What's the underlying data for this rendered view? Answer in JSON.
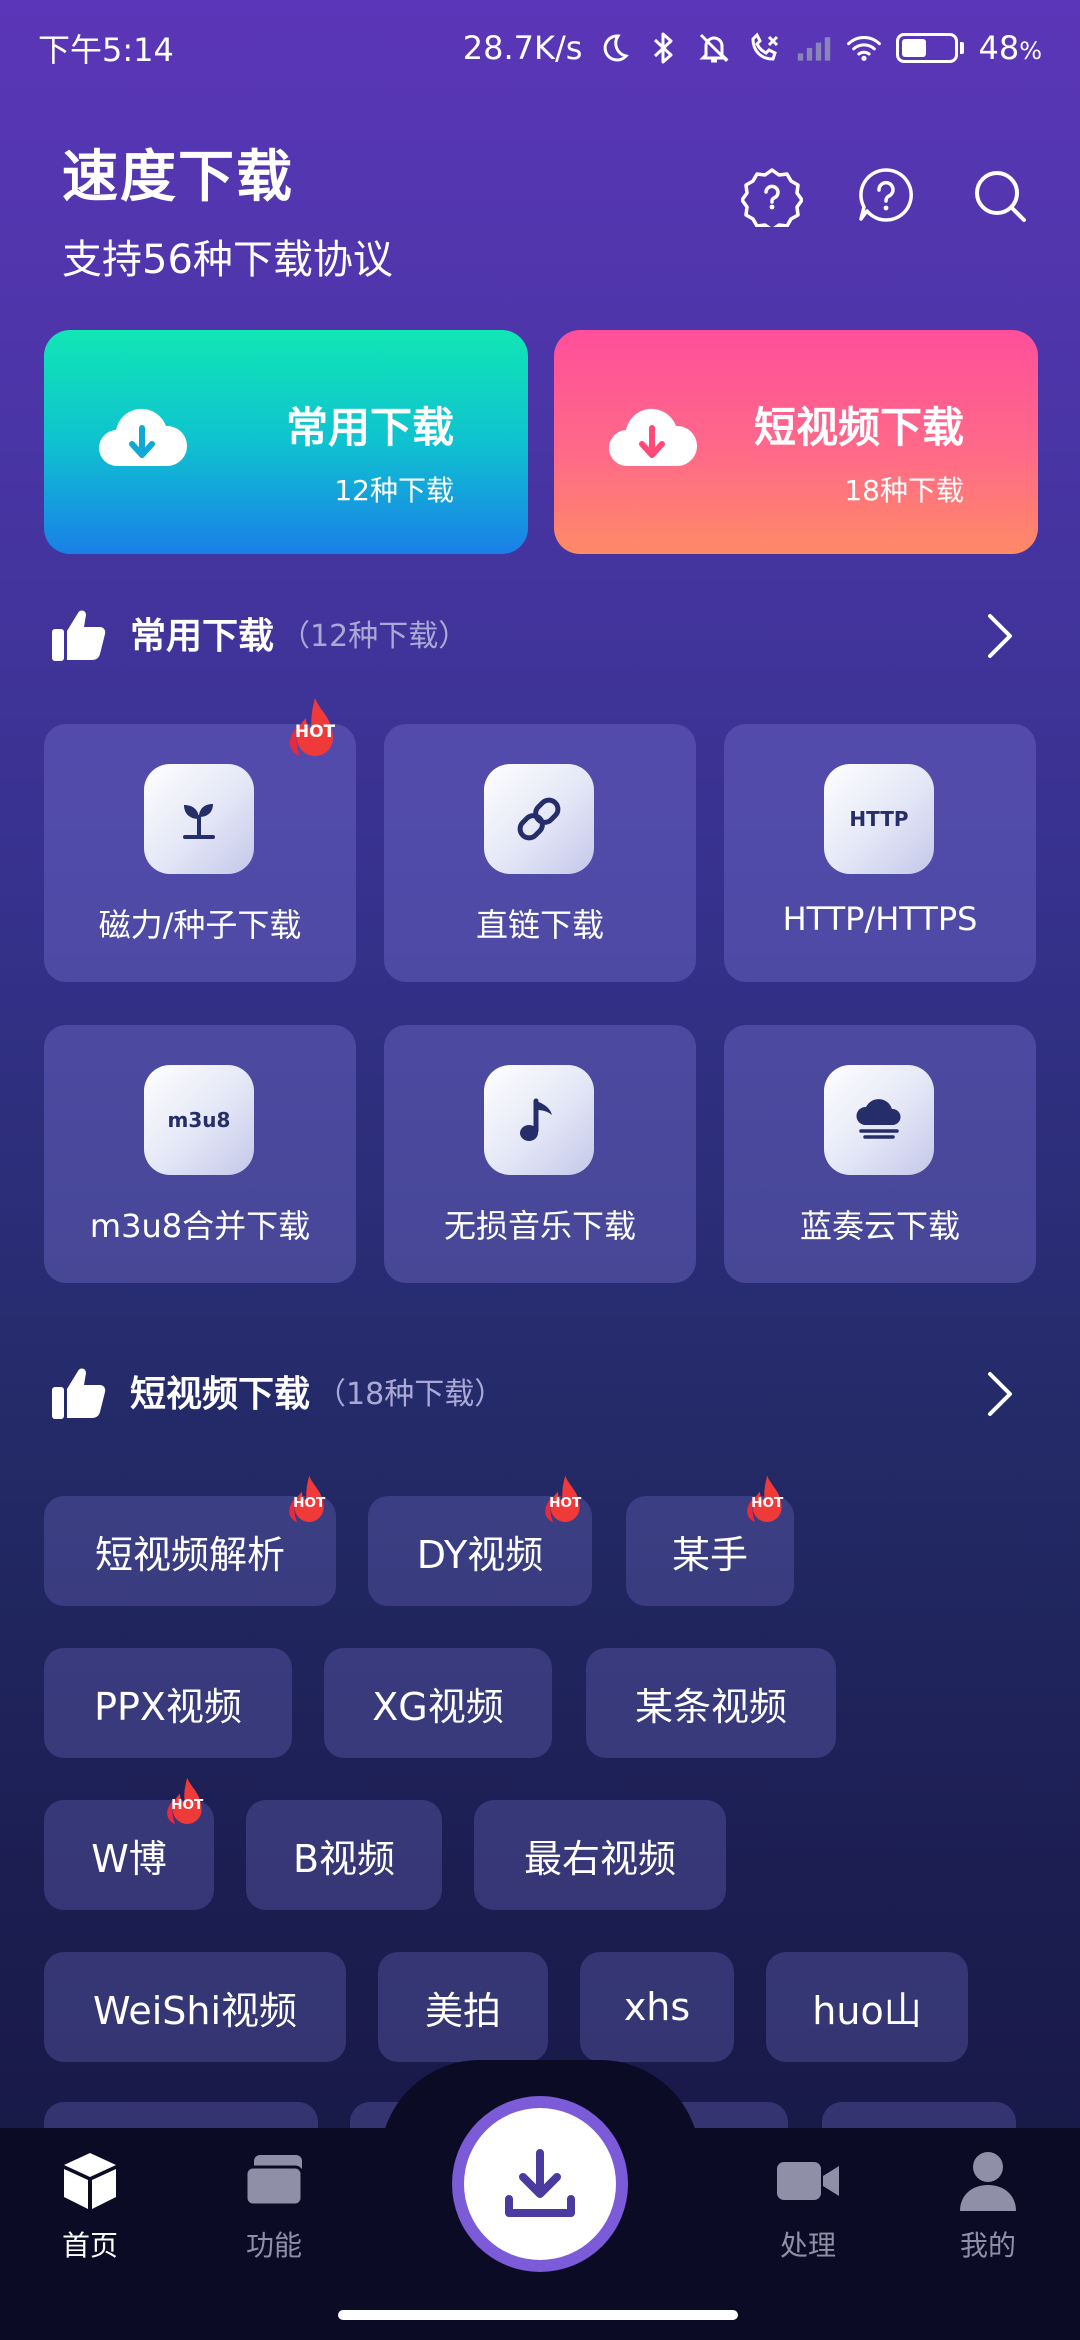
{
  "status_bar": {
    "time": "下午5:14",
    "speed": "28.7K/s",
    "battery": "48",
    "battery_unit": "%",
    "battery_level": 0.48
  },
  "header": {
    "title": "速度下载",
    "subtitle": "支持56种下载协议",
    "icons": [
      "settings-icon",
      "help-icon",
      "search-icon"
    ]
  },
  "big_cards": [
    {
      "title": "常用下载",
      "sub": "12种下载",
      "icon": "cloud-download-icon",
      "color": "#12d8c0"
    },
    {
      "title": "短视频下载",
      "sub": "18种下载",
      "icon": "cloud-download-icon",
      "color": "#ff5f8f"
    }
  ],
  "section_common": {
    "name": "常用下载",
    "count": "（12种下载）",
    "tiles": [
      {
        "label": "磁力/种子下载",
        "icon": "sprout-icon",
        "hot": true
      },
      {
        "label": "直链下载",
        "icon": "link-icon",
        "hot": false
      },
      {
        "label": "HTTP/HTTPS",
        "icon_text": "HTTP",
        "hot": false
      },
      {
        "label": "m3u8合并下载",
        "icon_text": "m3u8",
        "hot": false
      },
      {
        "label": "无损音乐下载",
        "icon": "music-note-icon",
        "hot": false
      },
      {
        "label": "蓝奏云下载",
        "icon": "cloud-icon",
        "hot": false
      }
    ]
  },
  "section_short": {
    "name": "短视频下载",
    "count": "（18种下载）",
    "chips": [
      {
        "label": "短视频解析",
        "hot": true
      },
      {
        "label": "DY视频",
        "hot": true
      },
      {
        "label": "某手",
        "hot": true
      },
      {
        "label": "PPX视频",
        "hot": false
      },
      {
        "label": "XG视频",
        "hot": false
      },
      {
        "label": "某条视频",
        "hot": false
      },
      {
        "label": "W博",
        "hot": true
      },
      {
        "label": "B视频",
        "hot": false
      },
      {
        "label": "最右视频",
        "hot": false
      },
      {
        "label": "WeiShi视频",
        "hot": false
      },
      {
        "label": "美拍",
        "hot": false
      },
      {
        "label": "xhs",
        "hot": false
      },
      {
        "label": "huo山",
        "hot": false
      }
    ]
  },
  "hot_label": "HOT",
  "bottom_nav": {
    "items": [
      {
        "label": "首页",
        "icon": "cube-icon",
        "active": true
      },
      {
        "label": "功能",
        "icon": "cards-icon",
        "active": false
      },
      {
        "label": "处理",
        "icon": "video-camera-icon",
        "active": false
      },
      {
        "label": "我的",
        "icon": "user-icon",
        "active": false
      }
    ],
    "fab_icon": "download-icon"
  }
}
